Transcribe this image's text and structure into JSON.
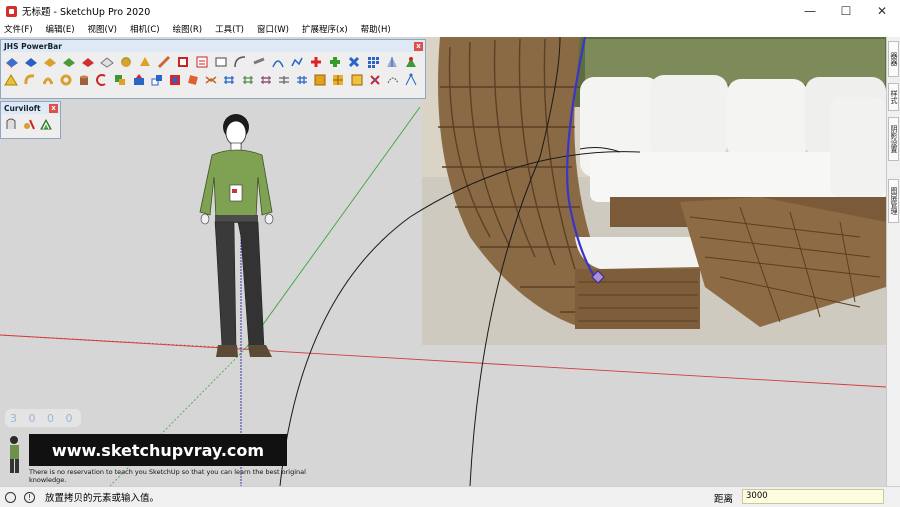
{
  "window": {
    "title": "无标题 - SketchUp Pro 2020",
    "controls": {
      "minimize": "—",
      "maximize": "☐",
      "close": "✕"
    }
  },
  "menu": [
    "文件(F)",
    "编辑(E)",
    "视图(V)",
    "相机(C)",
    "绘图(R)",
    "工具(T)",
    "窗口(W)",
    "扩展程序(x)",
    "帮助(H)"
  ],
  "toolbars": {
    "jhs": {
      "title": "JHS PowerBar",
      "close": "x"
    },
    "curviloft": {
      "title": "Curviloft",
      "close": "x"
    }
  },
  "right_tray": {
    "tabs": [
      "器器",
      "样式",
      "阴影设置",
      "图层管理"
    ]
  },
  "overlay": {
    "dimension_readout": "3 0 0 0",
    "website": "www.sketchupvray.com",
    "tagline": "There is no reservation to teach you SketchUp so that you can learn the best original knowledge."
  },
  "status": {
    "hint": "放置拷贝的元素或输入值。",
    "vcb_label": "距离",
    "vcb_value": "3000"
  },
  "colors": {
    "red_axis": "#d23c3c",
    "green_axis": "#3aa63a",
    "blue_axis": "#2a2aa8",
    "viewport_bg": "#d6d6d6"
  }
}
